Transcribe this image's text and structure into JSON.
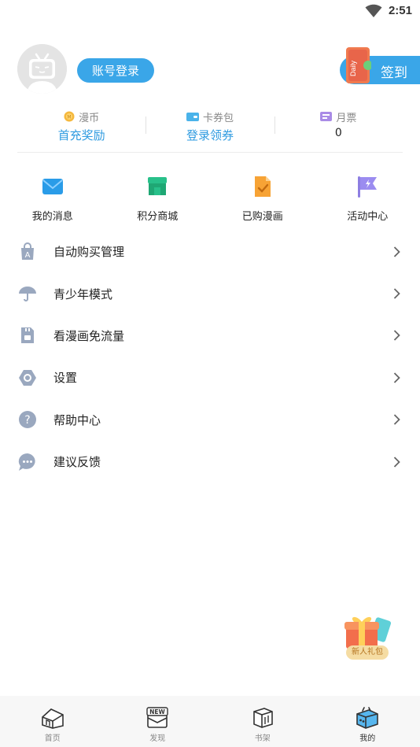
{
  "status_bar": {
    "time": "2:51"
  },
  "profile": {
    "login_label": "账号登录",
    "checkin_label": "签到",
    "checkin_card_text": "Daily"
  },
  "wallet": [
    {
      "icon": "coin-icon",
      "title": "漫币",
      "value": "首充奖励"
    },
    {
      "icon": "ticket-wallet-icon",
      "title": "卡券包",
      "value": "登录领券"
    },
    {
      "icon": "monthly-ticket-icon",
      "title": "月票",
      "value": "0"
    }
  ],
  "quick_actions": [
    {
      "icon": "mail-icon",
      "label": "我的消息"
    },
    {
      "icon": "shop-icon",
      "label": "积分商城"
    },
    {
      "icon": "purchased-comic-icon",
      "label": "已购漫画"
    },
    {
      "icon": "flag-icon",
      "label": "活动中心"
    }
  ],
  "menu": [
    {
      "icon": "shopping-bag-icon",
      "label": "自动购买管理"
    },
    {
      "icon": "umbrella-icon",
      "label": "青少年模式"
    },
    {
      "icon": "sim-card-icon",
      "label": "看漫画免流量"
    },
    {
      "icon": "settings-icon",
      "label": "设置"
    },
    {
      "icon": "help-icon",
      "label": "帮助中心"
    },
    {
      "icon": "feedback-icon",
      "label": "建议反馈"
    }
  ],
  "gift": {
    "label": "新人礼包"
  },
  "tabbar": [
    {
      "icon": "home-icon",
      "label": "首页"
    },
    {
      "icon": "discover-new-icon",
      "label": "发现",
      "badge": "NEW"
    },
    {
      "icon": "bookshelf-icon",
      "label": "书架"
    },
    {
      "icon": "mine-tv-icon",
      "label": "我的"
    }
  ],
  "colors": {
    "accent": "#3aa6e8",
    "menu_icon": "#9aa8bf",
    "tab_bg": "#f7f7f7"
  }
}
